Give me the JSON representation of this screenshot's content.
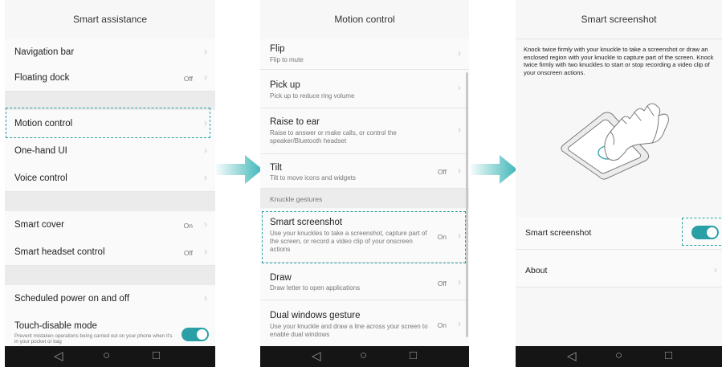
{
  "screen1": {
    "title": "Smart assistance",
    "items": [
      {
        "label": "Navigation bar"
      },
      {
        "label": "Floating dock",
        "value": "Off"
      },
      {
        "label": "Motion control"
      },
      {
        "label": "One-hand UI"
      },
      {
        "label": "Voice control"
      },
      {
        "label": "Smart cover",
        "value": "On"
      },
      {
        "label": "Smart headset control",
        "value": "Off"
      },
      {
        "label": "Scheduled power on and off"
      },
      {
        "label": "Touch-disable mode",
        "subtitle": "Prevent mistaken operations being carried out on your phone when it's in your pocket or bag",
        "toggle_on": true
      }
    ]
  },
  "screen2": {
    "title": "Motion control",
    "items": [
      {
        "label": "Flip",
        "subtitle": "Flip to mute"
      },
      {
        "label": "Pick up",
        "subtitle": "Pick up to reduce ring volume"
      },
      {
        "label": "Raise to ear",
        "subtitle": "Raise to answer or make calls, or control the speaker/Bluetooth headset"
      },
      {
        "label": "Tilt",
        "subtitle": "Tilt to move icons and widgets",
        "value": "Off"
      },
      {
        "label": "Smart screenshot",
        "subtitle": "Use your knuckles to take a screenshot, capture part of the screen, or record a video clip of your onscreen actions",
        "value": "On"
      },
      {
        "label": "Draw",
        "subtitle": "Draw letter to open applications",
        "value": "Off"
      },
      {
        "label": "Dual windows gesture",
        "subtitle": "Use your knuckle and draw a line across your screen to enable dual windows",
        "value": "On"
      }
    ],
    "section_header": "Knuckle gestures"
  },
  "screen3": {
    "title": "Smart screenshot",
    "description": "Knock twice firmly with your knuckle to take a screenshot or draw an enclosed region with your knuckle to capture part of the screen. Knock twice firmly with two knuckles to start or stop recording a video clip of your onscreen actions.",
    "toggle_label": "Smart screenshot",
    "toggle_on": true,
    "about_label": "About"
  },
  "navbar": {
    "back": "◁",
    "home": "○",
    "recent": "□"
  },
  "icons": {
    "chevron": "chevron-right-icon",
    "arrow": "arrow-right-icon",
    "back": "back-icon",
    "home": "home-icon",
    "recent": "recent-apps-icon",
    "illustration": "knuckle-phone-illustration"
  },
  "colors": {
    "accent": "#2a9fa6",
    "arrow_teal": "#3fb6b8",
    "navbar": "#151515"
  }
}
